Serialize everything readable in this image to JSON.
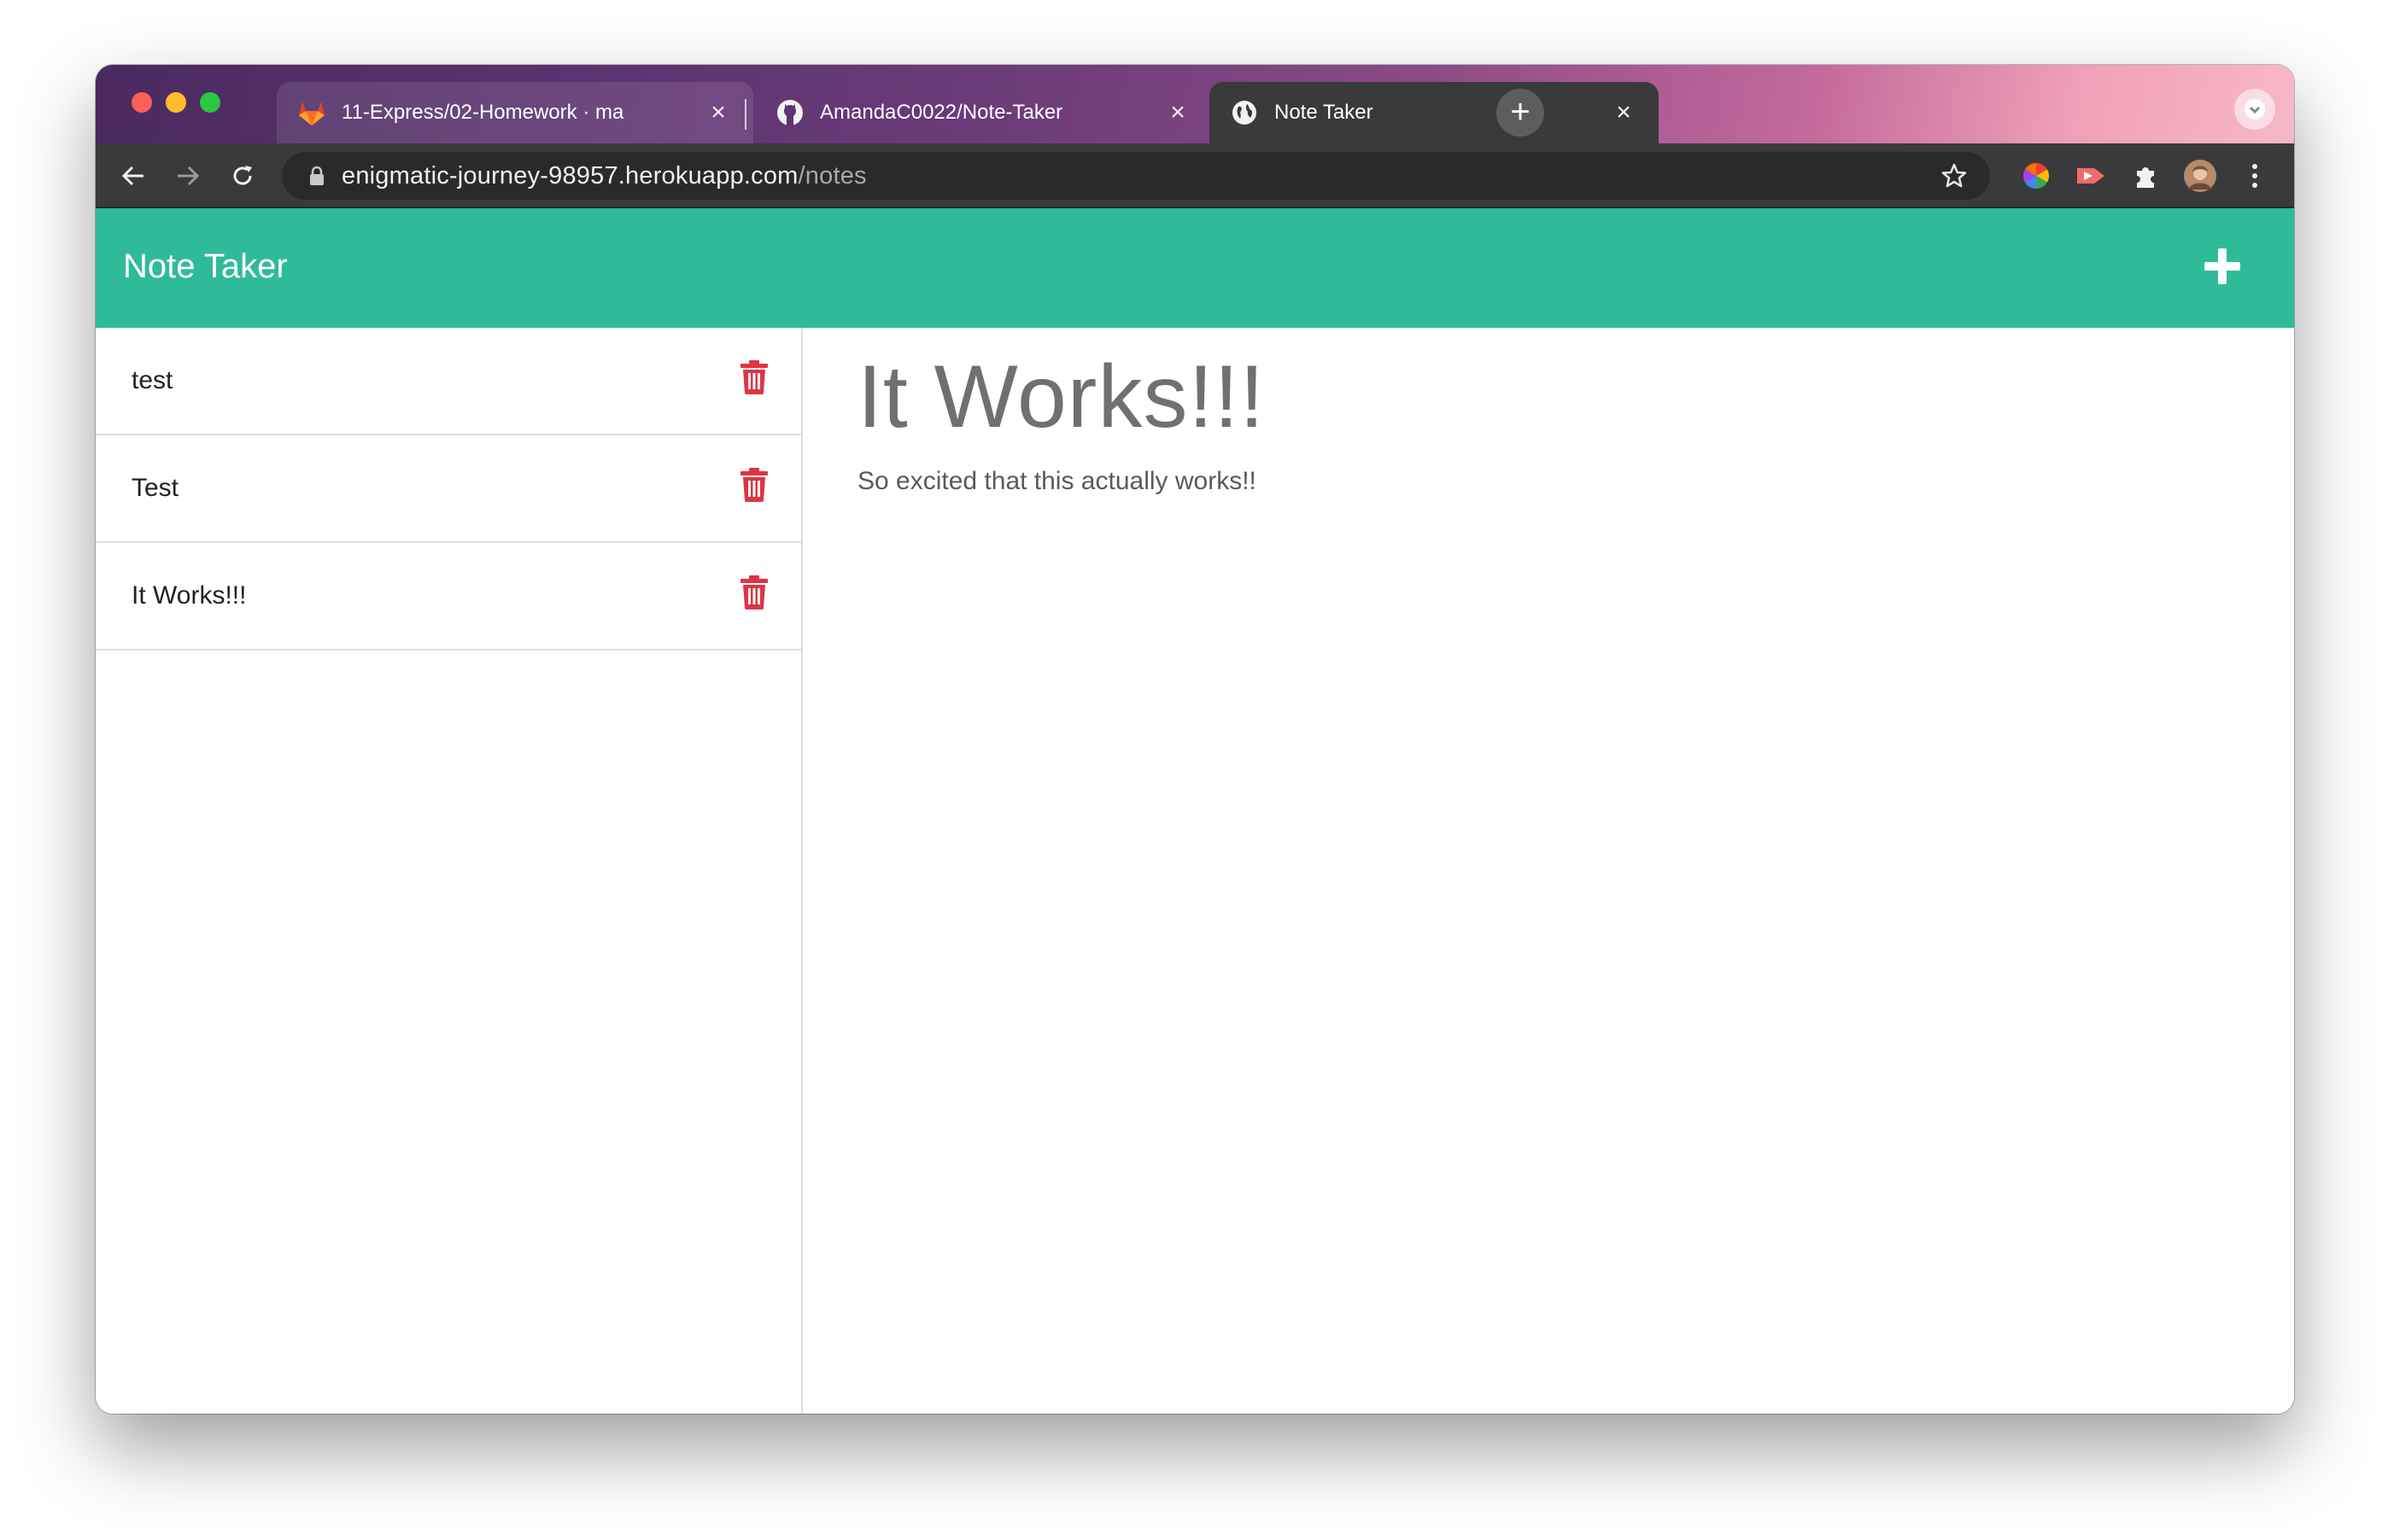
{
  "browser": {
    "tabs": [
      {
        "title": "11-Express/02-Homework · ma",
        "favicon": "gitlab-icon",
        "active": false
      },
      {
        "title": "AmandaC0022/Note-Taker",
        "favicon": "github-icon",
        "active": false
      },
      {
        "title": "Note Taker",
        "favicon": "globe-icon",
        "active": true
      }
    ],
    "url": {
      "host": "enigmatic-journey-98957.herokuapp.com",
      "path": "/notes"
    }
  },
  "app": {
    "brand": "Note Taker",
    "accent_color": "#2fbb99",
    "delete_color": "#dc3545",
    "notes": [
      {
        "title": "test"
      },
      {
        "title": "Test"
      },
      {
        "title": "It Works!!!"
      }
    ],
    "active_note": {
      "title": "It Works!!!",
      "text": "So excited that this actually works!!"
    }
  }
}
